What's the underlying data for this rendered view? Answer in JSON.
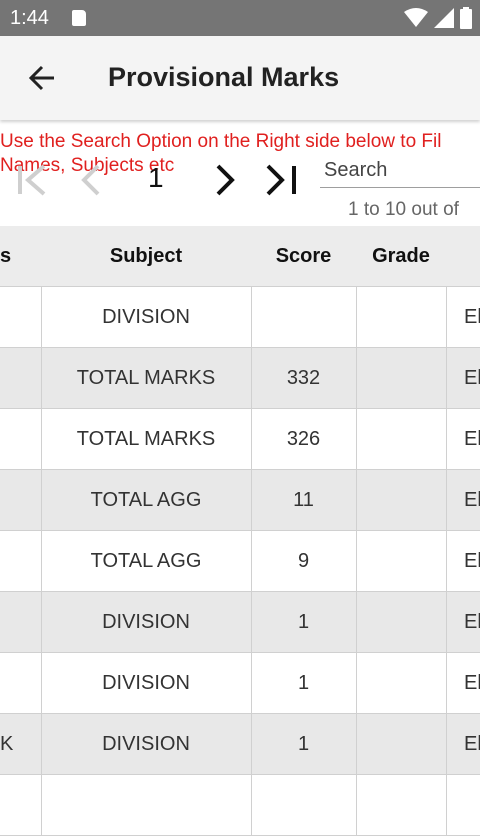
{
  "status": {
    "time": "1:44"
  },
  "appbar": {
    "title": "Provisional Marks"
  },
  "notice": [
    "Use the Search Option on the Right side below to Fil",
    "Names, Subjects etc"
  ],
  "pager": {
    "page": "1"
  },
  "search": {
    "placeholder": "Search"
  },
  "range_text": "1 to 10 out of ",
  "table": {
    "headers": [
      "s",
      "Subject",
      "Score",
      "Grade",
      ""
    ],
    "rows": [
      [
        "",
        "DIVISION",
        "",
        "",
        "El"
      ],
      [
        "",
        "TOTAL MARKS",
        "332",
        "",
        "El"
      ],
      [
        "",
        "TOTAL MARKS",
        "326",
        "",
        "El"
      ],
      [
        "",
        "TOTAL AGG",
        "11",
        "",
        "El"
      ],
      [
        "",
        "TOTAL AGG",
        "9",
        "",
        "El"
      ],
      [
        "",
        "DIVISION",
        "1",
        "",
        "El"
      ],
      [
        "",
        "DIVISION",
        "1",
        "",
        "El"
      ],
      [
        "K",
        "DIVISION",
        "1",
        "",
        "El"
      ],
      [
        "",
        "",
        "",
        "",
        ""
      ]
    ]
  },
  "colors": {
    "accent_red": "#e0201f",
    "appbar": "#f4f4f4",
    "statusbar": "#757575",
    "row_alt": "#e8e8e8"
  }
}
